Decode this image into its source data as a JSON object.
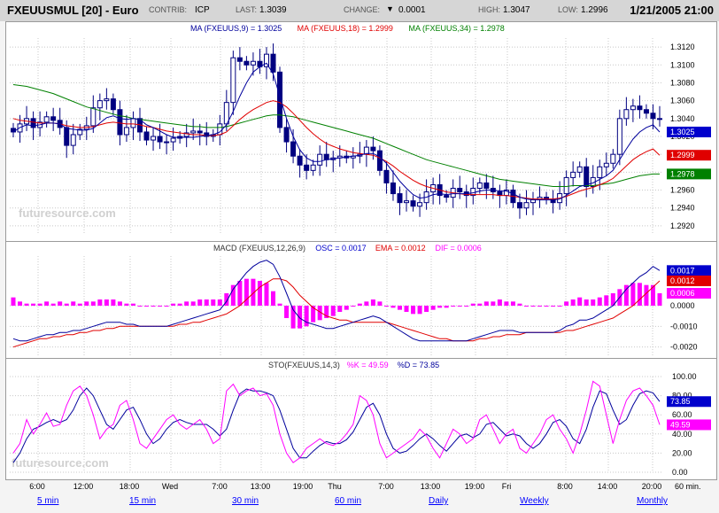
{
  "header": {
    "symbol": "FXEUUSMUL [20] - Euro",
    "contrib_label": "CONTRIB:",
    "contrib_value": "ICP",
    "last_label": "LAST:",
    "last_value": "1.3039",
    "change_label": "CHANGE:",
    "change_value": "0.0001",
    "high_label": "HIGH:",
    "high_value": "1.3047",
    "low_label": "LOW:",
    "low_value": "1.2996",
    "datetime": "1/21/2005 21:00"
  },
  "watermark": "futuresource.com",
  "nav": {
    "links": [
      "5 min",
      "15 min",
      "30 min",
      "60 min",
      "Daily",
      "Weekly",
      "Monthly"
    ]
  },
  "colors": {
    "blue": "#00009c",
    "red": "#e00000",
    "green": "#008000",
    "magenta": "#ff00ff",
    "candle": "#000080"
  },
  "chart_data": [
    {
      "type": "candlestick",
      "title_parts": [
        {
          "text": "MA (FXEUUS,9) = 1.3025",
          "color": "#00009c"
        },
        {
          "text": "MA (FXEUUS,18) = 1.2999",
          "color": "#e00000"
        },
        {
          "text": "MA (FXEUUS,34) = 1.2978",
          "color": "#008000"
        }
      ],
      "ylim": [
        1.291,
        1.313
      ],
      "yticks": [
        "1.3120",
        "1.3100",
        "1.3080",
        "1.3060",
        "1.3040",
        "1.3020",
        "1.3000",
        "1.2980",
        "1.2960",
        "1.2940",
        "1.2920"
      ],
      "value_tags": [
        {
          "text": "1.3025",
          "color": "#0000cc",
          "value": 1.3025
        },
        {
          "text": "1.2999",
          "color": "#e00000",
          "value": 1.2999
        },
        {
          "text": "1.2978",
          "color": "#008000",
          "value": 1.2978
        }
      ],
      "closes": [
        1.3025,
        1.3034,
        1.304,
        1.303,
        1.3036,
        1.3042,
        1.3038,
        1.303,
        1.301,
        1.3022,
        1.3028,
        1.3032,
        1.3052,
        1.306,
        1.3062,
        1.305,
        1.3022,
        1.303,
        1.304,
        1.3025,
        1.3016,
        1.302,
        1.3014,
        1.3014,
        1.3018,
        1.302,
        1.3024,
        1.3026,
        1.3024,
        1.302,
        1.3022,
        1.3034,
        1.3058,
        1.3108,
        1.3104,
        1.31,
        1.3104,
        1.3098,
        1.3112,
        1.3092,
        1.303,
        1.3014,
        1.2998,
        1.2988,
        1.2982,
        1.2988,
        1.3,
        1.2994,
        1.2996,
        1.2998,
        1.2996,
        1.2998,
        1.3,
        1.3008,
        1.3004,
        1.2982,
        1.2968,
        1.2956,
        1.2946,
        1.2948,
        1.2942,
        1.2946,
        1.2958,
        1.2966,
        1.2954,
        1.2952,
        1.2962,
        1.2958,
        1.2954,
        1.2962,
        1.2968,
        1.2962,
        1.2958,
        1.2954,
        1.296,
        1.2946,
        1.294,
        1.2946,
        1.295,
        1.2952,
        1.295,
        1.2946,
        1.2956,
        1.2974,
        1.298,
        1.2986,
        1.2964,
        1.2974,
        1.2986,
        1.299,
        1.3,
        1.304,
        1.305,
        1.3054,
        1.305,
        1.3046,
        1.304,
        1.3039
      ],
      "ma9": [
        1.3025,
        1.303,
        1.3033,
        1.3032,
        1.3033,
        1.3035,
        1.3035,
        1.3034,
        1.3029,
        1.3028,
        1.3027,
        1.3027,
        1.3029,
        1.3035,
        1.3041,
        1.3043,
        1.304,
        1.3039,
        1.304,
        1.3039,
        1.3033,
        1.303,
        1.3026,
        1.3022,
        1.3019,
        1.3019,
        1.3019,
        1.3019,
        1.302,
        1.3021,
        1.3022,
        1.3025,
        1.3033,
        1.3048,
        1.3065,
        1.308,
        1.3092,
        1.3098,
        1.3102,
        1.309,
        1.3065,
        1.304,
        1.302,
        1.3005,
        1.2996,
        1.2992,
        1.2992,
        1.2994,
        1.2995,
        1.2996,
        1.2997,
        1.2998,
        1.2999,
        1.3001,
        1.3001,
        1.2997,
        1.299,
        1.298,
        1.297,
        1.2962,
        1.2955,
        1.2951,
        1.2952,
        1.2955,
        1.2956,
        1.2955,
        1.2956,
        1.2956,
        1.2956,
        1.2957,
        1.2959,
        1.296,
        1.296,
        1.2959,
        1.2959,
        1.2956,
        1.2952,
        1.295,
        1.2949,
        1.2949,
        1.2949,
        1.2949,
        1.295,
        1.2954,
        1.2959,
        1.2964,
        1.2966,
        1.2968,
        1.2972,
        1.2976,
        1.2982,
        1.2994,
        1.3006,
        1.3017,
        1.3025,
        1.303,
        1.3033,
        1.3025
      ],
      "ma18": [
        1.304,
        1.3038,
        1.3037,
        1.3036,
        1.3035,
        1.3035,
        1.3035,
        1.3034,
        1.3032,
        1.3031,
        1.303,
        1.303,
        1.3031,
        1.3033,
        1.3035,
        1.3036,
        1.3035,
        1.3034,
        1.3034,
        1.3033,
        1.3031,
        1.303,
        1.3028,
        1.3026,
        1.3025,
        1.3024,
        1.3023,
        1.3022,
        1.3022,
        1.3021,
        1.3021,
        1.3022,
        1.3025,
        1.3032,
        1.3039,
        1.3045,
        1.305,
        1.3054,
        1.3058,
        1.306,
        1.3058,
        1.3053,
        1.3046,
        1.3038,
        1.303,
        1.3023,
        1.3017,
        1.3012,
        1.3009,
        1.3006,
        1.3004,
        1.3002,
        1.3001,
        1.3,
        1.2999,
        1.2996,
        1.2992,
        1.2987,
        1.2981,
        1.2976,
        1.2971,
        1.2967,
        1.2964,
        1.2962,
        1.296,
        1.2958,
        1.2957,
        1.2956,
        1.2955,
        1.2955,
        1.2955,
        1.2955,
        1.2955,
        1.2954,
        1.2954,
        1.2953,
        1.2952,
        1.2951,
        1.295,
        1.295,
        1.295,
        1.295,
        1.2951,
        1.2953,
        1.2956,
        1.2959,
        1.2961,
        1.2963,
        1.2966,
        1.2969,
        1.2973,
        1.298,
        1.2987,
        1.2994,
        1.2999,
        1.3003,
        1.3006,
        1.2999
      ],
      "ma34": [
        1.3078,
        1.3077,
        1.3076,
        1.3074,
        1.3072,
        1.307,
        1.3068,
        1.3065,
        1.3062,
        1.3059,
        1.3056,
        1.3053,
        1.3051,
        1.3049,
        1.3047,
        1.3045,
        1.3043,
        1.3042,
        1.304,
        1.3039,
        1.3038,
        1.3037,
        1.3036,
        1.3035,
        1.3034,
        1.3033,
        1.3032,
        1.3031,
        1.3031,
        1.303,
        1.303,
        1.303,
        1.3031,
        1.3033,
        1.3035,
        1.3037,
        1.3039,
        1.3041,
        1.3043,
        1.3044,
        1.3044,
        1.3043,
        1.3042,
        1.304,
        1.3038,
        1.3036,
        1.3034,
        1.3032,
        1.303,
        1.3028,
        1.3026,
        1.3024,
        1.3022,
        1.302,
        1.3018,
        1.3015,
        1.3012,
        1.3009,
        1.3006,
        1.3003,
        1.3,
        1.2997,
        1.2994,
        1.2992,
        1.299,
        1.2988,
        1.2986,
        1.2984,
        1.2982,
        1.298,
        1.2978,
        1.2976,
        1.2974,
        1.2972,
        1.2971,
        1.297,
        1.2969,
        1.2968,
        1.2967,
        1.2966,
        1.2965,
        1.2964,
        1.2964,
        1.2964,
        1.2965,
        1.2965,
        1.2965,
        1.2965,
        1.2966,
        1.2967,
        1.2968,
        1.297,
        1.2972,
        1.2974,
        1.2976,
        1.2977,
        1.2978,
        1.2978
      ]
    },
    {
      "type": "macd",
      "title_parts": [
        {
          "text": "MACD (FXEUUS,12,26,9)",
          "color": "#333333"
        },
        {
          "text": "OSC = 0.0017",
          "color": "#0000cc"
        },
        {
          "text": "EMA = 0.0012",
          "color": "#e00000"
        },
        {
          "text": "DIF = 0.0006",
          "color": "#ff00ff"
        }
      ],
      "ylim": [
        -0.0024,
        0.0024
      ],
      "yticks": [
        "0.0000",
        "-0.0010",
        "-0.0020"
      ],
      "value_tags": [
        {
          "text": "0.0017",
          "color": "#0000cc",
          "value": 0.0017
        },
        {
          "text": "0.0012",
          "color": "#e00000",
          "value": 0.0012
        },
        {
          "text": "0.0006",
          "color": "#ff00ff",
          "value": 0.0006
        }
      ],
      "osc": [
        -0.0016,
        -0.0017,
        -0.0017,
        -0.0016,
        -0.0015,
        -0.0014,
        -0.0014,
        -0.0013,
        -0.0013,
        -0.0012,
        -0.0012,
        -0.0011,
        -0.001,
        -0.0009,
        -0.0008,
        -0.0008,
        -0.0008,
        -0.0009,
        -0.0009,
        -0.001,
        -0.001,
        -0.001,
        -0.001,
        -0.001,
        -0.0009,
        -0.0008,
        -0.0007,
        -0.0006,
        -0.0005,
        -0.0004,
        -0.0003,
        -0.0002,
        0.0002,
        0.0008,
        0.0012,
        0.0016,
        0.0019,
        0.0021,
        0.0022,
        0.002,
        0.0014,
        0.0006,
        -0.0002,
        -0.0006,
        -0.0008,
        -0.0009,
        -0.001,
        -0.0011,
        -0.0011,
        -0.001,
        -0.0009,
        -0.0008,
        -0.0007,
        -0.0006,
        -0.0005,
        -0.0006,
        -0.0008,
        -0.001,
        -0.0012,
        -0.0014,
        -0.0016,
        -0.0017,
        -0.0017,
        -0.0017,
        -0.0017,
        -0.0017,
        -0.0017,
        -0.0017,
        -0.0017,
        -0.0016,
        -0.0015,
        -0.0014,
        -0.0013,
        -0.0012,
        -0.0012,
        -0.0012,
        -0.0013,
        -0.0013,
        -0.0013,
        -0.0013,
        -0.0013,
        -0.0013,
        -0.0012,
        -0.001,
        -0.0009,
        -0.0007,
        -0.0007,
        -0.0006,
        -0.0004,
        -0.0002,
        0.0,
        0.0004,
        0.0008,
        0.0011,
        0.0014,
        0.0016,
        0.0019,
        0.0017
      ],
      "ema": [
        -0.002,
        -0.0019,
        -0.0018,
        -0.0017,
        -0.0016,
        -0.0016,
        -0.0015,
        -0.0015,
        -0.0014,
        -0.0014,
        -0.0013,
        -0.0013,
        -0.0012,
        -0.0012,
        -0.0011,
        -0.0011,
        -0.001,
        -0.001,
        -0.001,
        -0.001,
        -0.001,
        -0.001,
        -0.001,
        -0.001,
        -0.001,
        -0.0009,
        -0.0009,
        -0.0008,
        -0.0008,
        -0.0007,
        -0.0006,
        -0.0005,
        -0.0004,
        -0.0002,
        0.0,
        0.0003,
        0.0006,
        0.0009,
        0.0011,
        0.0013,
        0.0013,
        0.0012,
        0.0009,
        0.0005,
        0.0002,
        -0.0001,
        -0.0003,
        -0.0005,
        -0.0006,
        -0.0007,
        -0.0007,
        -0.0008,
        -0.0008,
        -0.0008,
        -0.0008,
        -0.0008,
        -0.0008,
        -0.0009,
        -0.001,
        -0.0011,
        -0.0012,
        -0.0013,
        -0.0014,
        -0.0015,
        -0.0016,
        -0.0016,
        -0.0017,
        -0.0017,
        -0.0017,
        -0.0017,
        -0.0016,
        -0.0016,
        -0.0015,
        -0.0015,
        -0.0014,
        -0.0014,
        -0.0014,
        -0.0013,
        -0.0013,
        -0.0013,
        -0.0013,
        -0.0013,
        -0.0013,
        -0.0012,
        -0.0012,
        -0.0011,
        -0.001,
        -0.0009,
        -0.0008,
        -0.0007,
        -0.0006,
        -0.0004,
        -0.0002,
        0.0,
        0.0003,
        0.0006,
        0.0009,
        0.0012
      ],
      "dif": [
        0.0004,
        0.0002,
        0.0001,
        0.0001,
        0.0001,
        0.0002,
        0.0001,
        0.0002,
        0.0001,
        0.0002,
        0.0001,
        0.0002,
        0.0002,
        0.0003,
        0.0003,
        0.0003,
        0.0002,
        0.0001,
        0.0001,
        0.0,
        0.0,
        0.0,
        0.0,
        0.0,
        0.0001,
        0.0001,
        0.0002,
        0.0002,
        0.0003,
        0.0003,
        0.0003,
        0.0003,
        0.0006,
        0.001,
        0.0012,
        0.0013,
        0.0013,
        0.0012,
        0.0011,
        0.0007,
        0.0001,
        -0.0006,
        -0.0011,
        -0.0011,
        -0.001,
        -0.0008,
        -0.0007,
        -0.0006,
        -0.0005,
        -0.0003,
        -0.0002,
        0.0,
        0.0001,
        0.0002,
        0.0003,
        0.0002,
        0.0,
        -0.0001,
        -0.0002,
        -0.0003,
        -0.0004,
        -0.0004,
        -0.0003,
        -0.0002,
        -0.0001,
        -0.0001,
        0.0,
        0.0,
        0.0,
        0.0001,
        0.0001,
        0.0002,
        0.0002,
        0.0003,
        0.0002,
        0.0002,
        0.0001,
        0.0,
        0.0,
        0.0,
        0.0,
        0.0,
        0.0,
        0.0002,
        0.0003,
        0.0004,
        0.0003,
        0.0003,
        0.0004,
        0.0005,
        0.0006,
        0.0008,
        0.001,
        0.0011,
        0.0011,
        0.001,
        0.001,
        0.0006
      ]
    },
    {
      "type": "stochastic",
      "title_parts": [
        {
          "text": "STO(FXEUUS,14,3)",
          "color": "#333333"
        },
        {
          "text": "%K = 49.59",
          "color": "#ff00ff"
        },
        {
          "text": "%D = 73.85",
          "color": "#00009c"
        }
      ],
      "ylim": [
        0,
        100
      ],
      "yticks": [
        "100.00",
        "80.00",
        "60.00",
        "40.00",
        "20.00",
        "0.00"
      ],
      "value_tags": [
        {
          "text": "73.85",
          "color": "#0000cc",
          "value": 73.85
        },
        {
          "text": "49.59",
          "color": "#ff00ff",
          "value": 49.59
        }
      ],
      "k": [
        20,
        30,
        55,
        40,
        50,
        62,
        48,
        50,
        70,
        85,
        90,
        80,
        60,
        35,
        45,
        50,
        70,
        75,
        55,
        30,
        25,
        35,
        45,
        55,
        60,
        50,
        45,
        50,
        55,
        45,
        30,
        35,
        85,
        92,
        80,
        85,
        88,
        80,
        82,
        70,
        40,
        20,
        10,
        15,
        25,
        30,
        35,
        30,
        28,
        32,
        40,
        50,
        80,
        75,
        60,
        30,
        15,
        20,
        25,
        30,
        35,
        45,
        38,
        25,
        15,
        30,
        45,
        40,
        30,
        35,
        55,
        60,
        45,
        30,
        40,
        45,
        25,
        20,
        30,
        40,
        55,
        60,
        45,
        35,
        20,
        40,
        65,
        95,
        90,
        60,
        30,
        55,
        75,
        85,
        88,
        80,
        70,
        49.59
      ],
      "d": [
        10,
        20,
        35,
        45,
        48,
        52,
        55,
        52,
        55,
        65,
        80,
        88,
        80,
        65,
        50,
        45,
        55,
        65,
        68,
        55,
        40,
        30,
        35,
        45,
        52,
        55,
        52,
        50,
        50,
        50,
        45,
        38,
        45,
        65,
        82,
        87,
        85,
        85,
        83,
        80,
        65,
        45,
        25,
        15,
        15,
        22,
        28,
        32,
        30,
        30,
        34,
        42,
        55,
        68,
        72,
        60,
        40,
        25,
        20,
        22,
        28,
        35,
        40,
        35,
        28,
        22,
        30,
        38,
        40,
        36,
        40,
        50,
        52,
        45,
        38,
        40,
        38,
        30,
        25,
        30,
        40,
        52,
        55,
        48,
        35,
        30,
        45,
        68,
        85,
        82,
        65,
        50,
        55,
        70,
        82,
        85,
        83,
        73.85
      ]
    }
  ],
  "time_axis": {
    "labels": [
      "6:00",
      "12:00",
      "18:00",
      "Wed",
      "7:00",
      "13:00",
      "19:00",
      "Thu",
      "7:00",
      "13:00",
      "19:00",
      "Fri",
      "8:00",
      "14:00",
      "20:00"
    ],
    "unit": "60 min."
  }
}
